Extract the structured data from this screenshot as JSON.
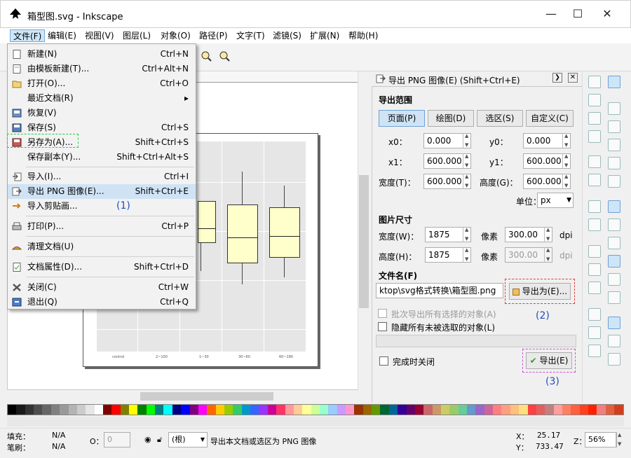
{
  "window": {
    "title": "箱型图.svg - Inkscape",
    "minimize": "—",
    "maximize": "☐",
    "close": "✕"
  },
  "menubar": [
    "文件(F)",
    "编辑(E)",
    "视图(V)",
    "图层(L)",
    "对象(O)",
    "路径(P)",
    "文字(T)",
    "滤镜(S)",
    "扩展(N)",
    "帮助(H)"
  ],
  "file_menu": {
    "items": [
      {
        "label": "新建(N)",
        "accel": "Ctrl+N",
        "icon": "new-doc-icon"
      },
      {
        "label": "由模板新建(T)...",
        "accel": "Ctrl+Alt+N",
        "icon": "template-icon"
      },
      {
        "label": "打开(O)...",
        "accel": "Ctrl+O",
        "icon": "open-folder-icon"
      },
      {
        "label": "最近文档(R)",
        "accel": "▸",
        "icon": ""
      },
      {
        "label": "恢复(V)",
        "accel": "",
        "icon": "revert-icon"
      },
      {
        "label": "保存(S)",
        "accel": "Ctrl+S",
        "icon": "save-icon"
      },
      {
        "label": "另存为(A)...",
        "accel": "Shift+Ctrl+S",
        "icon": "save-as-icon"
      },
      {
        "label": "保存副本(Y)...",
        "accel": "Shift+Ctrl+Alt+S",
        "icon": ""
      },
      {
        "label": "导入(I)...",
        "accel": "Ctrl+I",
        "icon": "import-icon"
      },
      {
        "label": "导出 PNG 图像(E)...",
        "accel": "Shift+Ctrl+E",
        "icon": "export-png-icon"
      },
      {
        "label": "导入剪贴画...",
        "accel": "",
        "icon": "clipart-icon"
      },
      {
        "label": "打印(P)...",
        "accel": "Ctrl+P",
        "icon": "print-icon"
      },
      {
        "label": "清理文档(U)",
        "accel": "",
        "icon": "cleanup-icon"
      },
      {
        "label": "文档属性(D)...",
        "accel": "Shift+Ctrl+D",
        "icon": "doc-props-icon"
      },
      {
        "label": "关闭(C)",
        "accel": "Ctrl+W",
        "icon": "close-doc-icon"
      },
      {
        "label": "退出(Q)",
        "accel": "Ctrl+Q",
        "icon": "quit-icon"
      }
    ]
  },
  "annotations": {
    "step1": "(1)",
    "step2": "(2)",
    "step3": "(3)"
  },
  "canvas": {
    "xticks": [
      "control",
      "2~100",
      "1~30",
      "30~60",
      "60~180"
    ]
  },
  "export_dialog": {
    "title": "导出 PNG 图像(E) (Shift+Ctrl+E)",
    "area_label": "导出范围",
    "area_buttons": [
      "页面(P)",
      "绘图(D)",
      "选区(S)",
      "自定义(C)"
    ],
    "x0_label": "x0：",
    "x0": "0.000",
    "y0_label": "y0：",
    "y0": "0.000",
    "x1_label": "x1：",
    "x1": "600.000",
    "y1_label": "y1：",
    "y1": "600.000",
    "width_label": "宽度(T)：",
    "width": "600.000",
    "height_label": "高度(G)：",
    "height": "600.000",
    "units_label": "单位：",
    "units": "px",
    "image_size_label": "图片尺寸",
    "px_width_label": "宽度(W)：",
    "px_width": "1875",
    "px_height_label": "高度(H)：",
    "px_height": "1875",
    "pixels_label": "像素",
    "dpi_label": "dpi",
    "dpi": "300.00",
    "dpi2": "300.00",
    "filename_label": "文件名(F)",
    "filename": "ktop\\svg格式转换\\箱型图.png",
    "export_as_button": "导出为(E)...",
    "batch_label": "批次导出所有选择的对象(A)",
    "hide_label": "隐藏所有未被选取的对象(L)",
    "close_when_done_label": "完成时关闭",
    "export_button": "导出(E)"
  },
  "status": {
    "fill_label": "填充：",
    "fill_value": "N/A",
    "stroke_label": "笔刷：",
    "stroke_value": "N/A",
    "opacity_label": "O：",
    "opacity": "0",
    "layer": "(根)",
    "message": "导出本文档或选区为 PNG 图像",
    "x_label": "X：",
    "x": "25.17",
    "y_label": "Y：",
    "y": "733.47",
    "zoom_label": "Z：",
    "zoom": "56%"
  },
  "palette_colors": [
    "#000000",
    "#1a1a1a",
    "#333333",
    "#4d4d4d",
    "#666666",
    "#808080",
    "#999999",
    "#b3b3b3",
    "#cccccc",
    "#e6e6e6",
    "#ffffff",
    "#800000",
    "#ff0000",
    "#808000",
    "#ffff00",
    "#008000",
    "#00ff00",
    "#008080",
    "#00ffff",
    "#000080",
    "#0000ff",
    "#800080",
    "#ff00ff",
    "#ff6600",
    "#ffcc00",
    "#99cc00",
    "#33cc66",
    "#0099cc",
    "#3366ff",
    "#9933ff",
    "#cc0099",
    "#ff3366",
    "#ff9999",
    "#ffcc99",
    "#ffff99",
    "#ccff99",
    "#99ffcc",
    "#99ccff",
    "#cc99ff",
    "#ff99cc",
    "#993300",
    "#996600",
    "#669900",
    "#006633",
    "#006699",
    "#330099",
    "#660066",
    "#990033",
    "#cc6666",
    "#cc9966",
    "#cccc66",
    "#99cc66",
    "#66cc99",
    "#6699cc",
    "#9966cc",
    "#cc6699",
    "#ff7f7f",
    "#ff9f7f",
    "#ffbf7f",
    "#ffdf7f",
    "#ff4040",
    "#e06060",
    "#c08080",
    "#ffa0a0",
    "#ff8060",
    "#ff6040",
    "#ff4020",
    "#ff2000",
    "#f08080",
    "#e06040",
    "#d04020"
  ]
}
